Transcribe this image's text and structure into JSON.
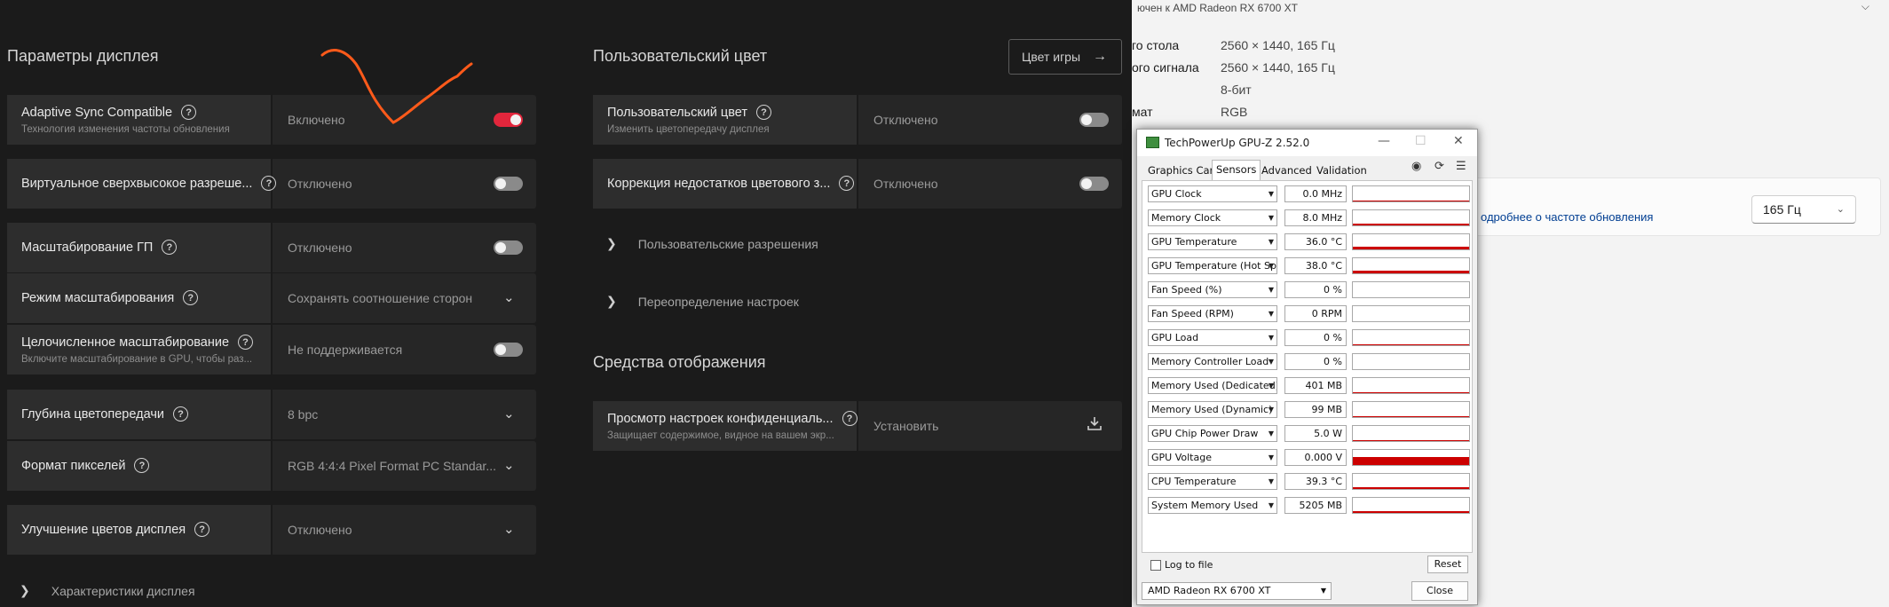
{
  "amd": {
    "display_section_title": "Параметры дисплея",
    "color_section_title": "Пользовательский цвет",
    "game_color_button": "Цвет игры",
    "tools_section_title": "Средства отображения",
    "rows": [
      {
        "title": "Adaptive Sync Compatible",
        "subtitle": "Технология изменения частоты обновления",
        "value": "Включено",
        "control": "toggle-on"
      },
      {
        "title": "Виртуальное сверхвысокое разреше...",
        "value": "Отключено",
        "control": "toggle-off"
      },
      {
        "title": "Масштабирование ГП",
        "value": "Отключено",
        "control": "toggle-off"
      },
      {
        "title": "Режим масштабирования",
        "value": "Сохранять соотношение сторон",
        "control": "dropdown"
      },
      {
        "title": "Целочисленное масштабирование",
        "subtitle": "Включите масштабирование в GPU, чтобы раз...",
        "value": "Не поддерживается",
        "control": "toggle-off"
      },
      {
        "title": "Глубина цветопередачи",
        "value": "8 bpc",
        "control": "dropdown"
      },
      {
        "title": "Формат пикселей",
        "value": "RGB 4:4:4 Pixel Format PC Standar...",
        "control": "dropdown"
      },
      {
        "title": "Улучшение цветов дисплея",
        "value": "Отключено",
        "control": "dropdown"
      }
    ],
    "display_specs_link": "Характеристики дисплея",
    "color_rows": [
      {
        "title": "Пользовательский цвет",
        "subtitle": "Изменить цветопередачу дисплея",
        "value": "Отключено"
      },
      {
        "title": "Коррекция недостатков цветового з...",
        "value": "Отключено"
      }
    ],
    "custom_resolutions_link": "Пользовательские разрешения",
    "override_settings_link": "Переопределение настроек",
    "privacy_row": {
      "title": "Просмотр настроек конфиденциаль...",
      "subtitle": "Защищает содержимое, видное на вашем экр...",
      "action": "Установить"
    }
  },
  "windows_settings": {
    "connected_to": "ючен к AMD Radeon RX 6700 XT",
    "specs": [
      {
        "label": "го стола",
        "value": "2560 × 1440, 165 Гц"
      },
      {
        "label": "ого сигнала",
        "value": "2560 × 1440, 165 Гц"
      },
      {
        "label": "",
        "value": "8-бит"
      },
      {
        "label": "мат",
        "value": "RGB"
      }
    ],
    "refresh_link": "одробнее о частоте обновления",
    "refresh_value": "165 Гц"
  },
  "gpuz": {
    "title": "TechPowerUp GPU-Z 2.52.0",
    "tabs": [
      "Graphics Card",
      "Sensors",
      "Advanced",
      "Validation"
    ],
    "active_tab": "Sensors",
    "sensors": [
      {
        "name": "GPU Clock",
        "value": "0.0 MHz",
        "level": 0.05
      },
      {
        "name": "Memory Clock",
        "value": "8.0 MHz",
        "level": 0.1
      },
      {
        "name": "GPU Temperature",
        "value": "36.0 °C",
        "level": 0.2
      },
      {
        "name": "GPU Temperature (Hot Spot)",
        "value": "38.0 °C",
        "level": 0.2
      },
      {
        "name": "Fan Speed (%)",
        "value": "0 %",
        "level": 0
      },
      {
        "name": "Fan Speed (RPM)",
        "value": "0 RPM",
        "level": 0
      },
      {
        "name": "GPU Load",
        "value": "0 %",
        "level": 0.03
      },
      {
        "name": "Memory Controller Load",
        "value": "0 %",
        "level": 0
      },
      {
        "name": "Memory Used (Dedicated)",
        "value": "401 MB",
        "level": 0.06
      },
      {
        "name": "Memory Used (Dynamic)",
        "value": "99 MB",
        "level": 0.03
      },
      {
        "name": "GPU Chip Power Draw",
        "value": "5.0 W",
        "level": 0.06
      },
      {
        "name": "GPU Voltage",
        "value": "0.000 V",
        "level": 0.5
      },
      {
        "name": "CPU Temperature",
        "value": "39.3 °C",
        "level": 0.1
      },
      {
        "name": "System Memory Used",
        "value": "5205 MB",
        "level": 0.12
      }
    ],
    "log_to_file": "Log to file",
    "reset": "Reset",
    "gpu_select": "AMD Radeon RX 6700 XT",
    "close": "Close"
  },
  "colors": {
    "accent_red": "#e2263c",
    "annotation_orange": "#ff5a1a",
    "graph_red": "#cc0000"
  }
}
